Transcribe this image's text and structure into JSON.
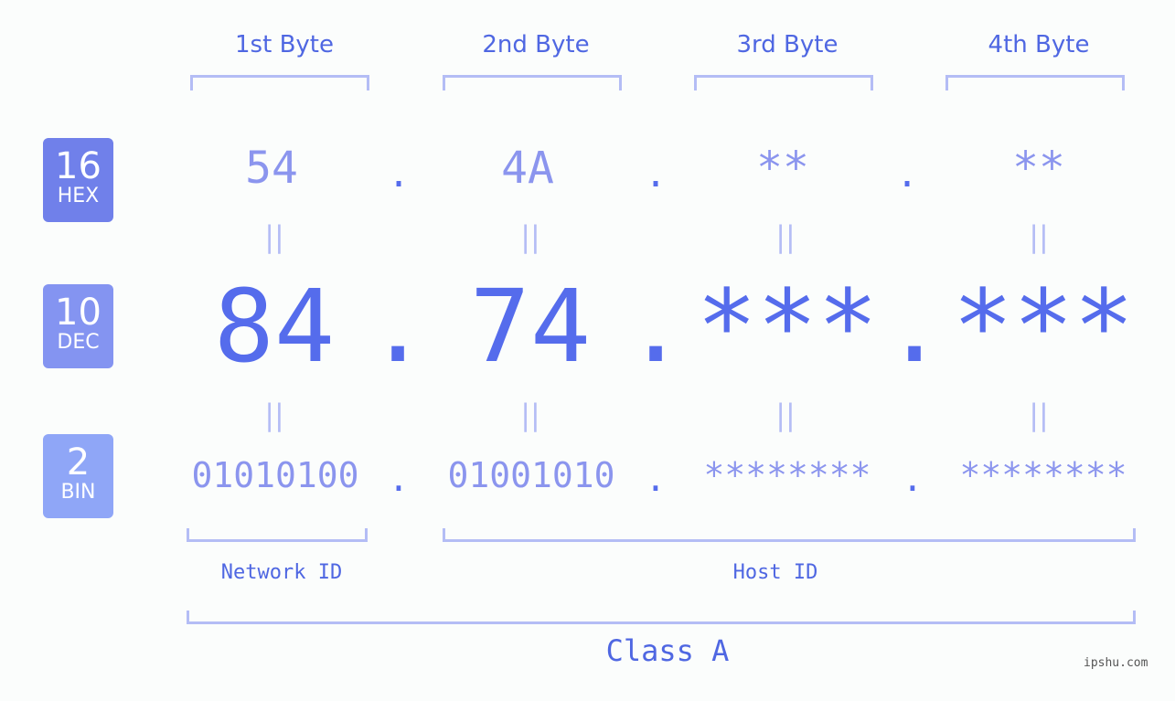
{
  "headers": [
    "1st Byte",
    "2nd Byte",
    "3rd Byte",
    "4th Byte"
  ],
  "bases": [
    {
      "num": "16",
      "label": "HEX",
      "color": "#7080ea"
    },
    {
      "num": "10",
      "label": "DEC",
      "color": "#8494f1"
    },
    {
      "num": "2",
      "label": "BIN",
      "color": "#8fa6f7"
    }
  ],
  "hex": [
    "54",
    "4A",
    "**",
    "**"
  ],
  "dec": [
    "84",
    "74",
    "***",
    "***"
  ],
  "bin": [
    "01010100",
    "01001010",
    "********",
    "********"
  ],
  "separator": ".",
  "equals": "||",
  "network_label": "Network ID",
  "host_label": "Host ID",
  "class_label": "Class A",
  "watermark": "ipshu.com"
}
